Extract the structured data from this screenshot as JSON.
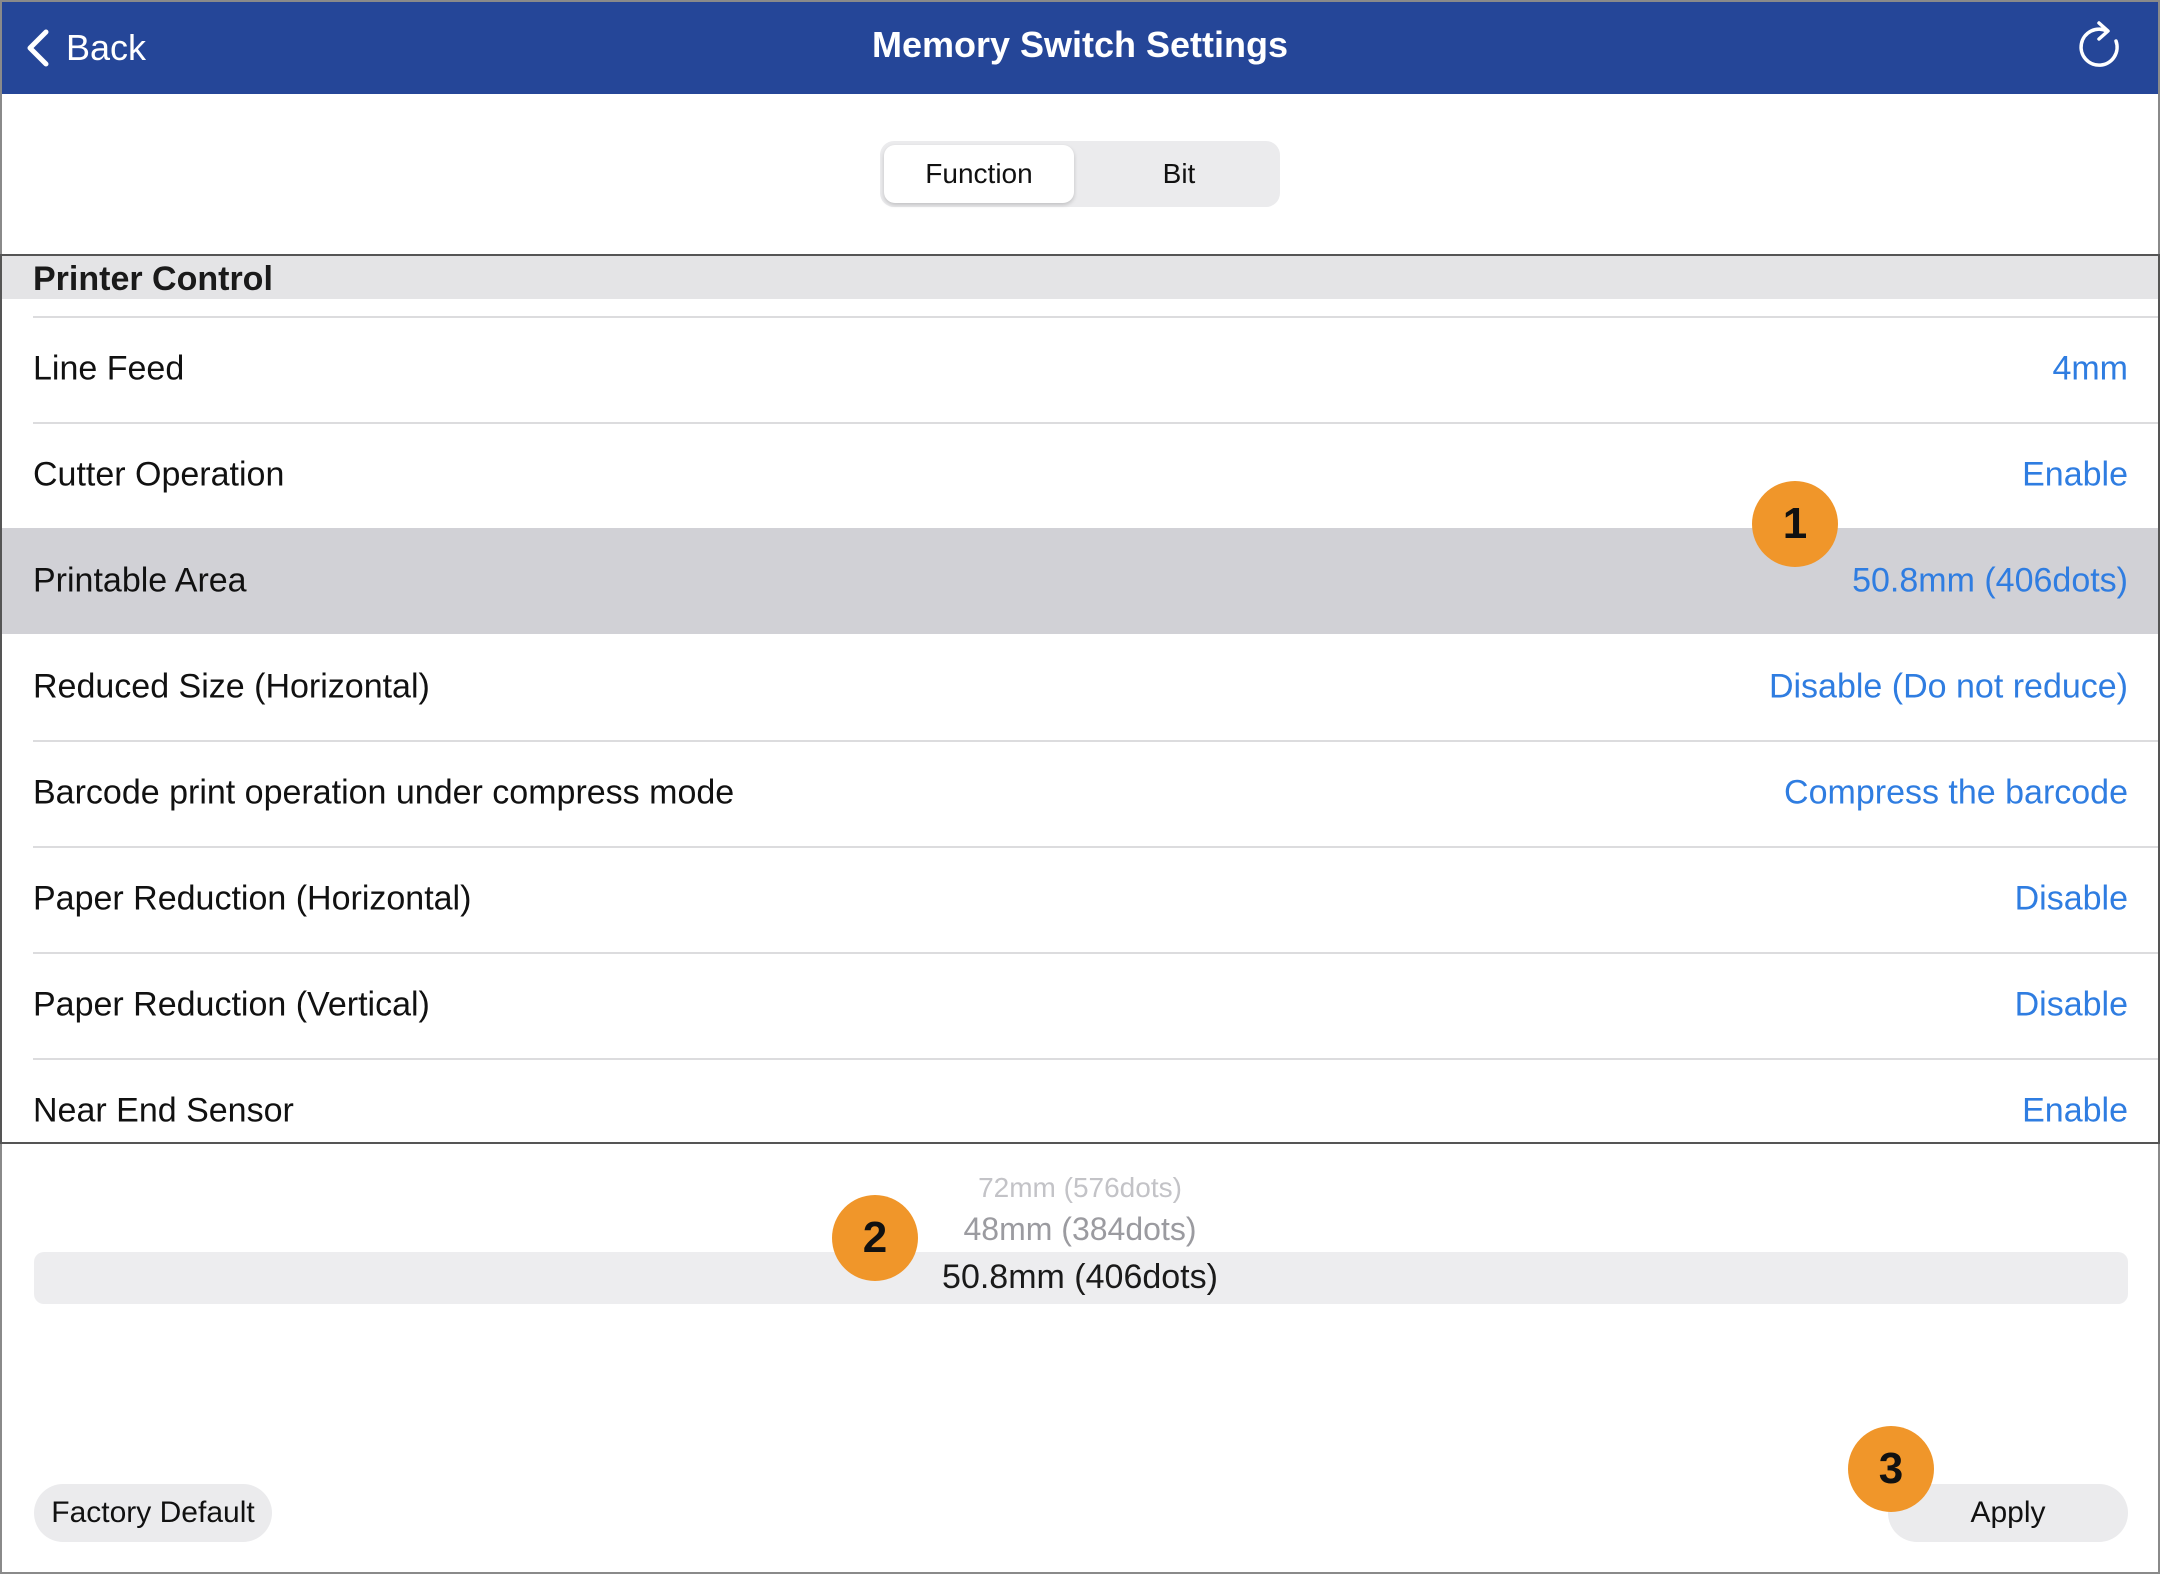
{
  "nav": {
    "back_label": "Back",
    "title": "Memory Switch Settings",
    "bar_color": "#254698"
  },
  "tabs": [
    {
      "label": "Function",
      "selected": true
    },
    {
      "label": "Bit",
      "selected": false
    }
  ],
  "section": {
    "title": "Printer Control"
  },
  "rows": [
    {
      "label": "Line Feed",
      "value": "4mm"
    },
    {
      "label": "Cutter Operation",
      "value": "Enable"
    },
    {
      "label": "Printable Area",
      "value": "50.8mm (406dots)",
      "selected": true
    },
    {
      "label": "Reduced Size (Horizontal)",
      "value": "Disable (Do not reduce)"
    },
    {
      "label": "Barcode print operation under compress mode",
      "value": "Compress the barcode"
    },
    {
      "label": "Paper Reduction (Horizontal)",
      "value": "Disable"
    },
    {
      "label": "Paper Reduction (Vertical)",
      "value": "Disable"
    },
    {
      "label": "Near End Sensor",
      "value": "Enable"
    }
  ],
  "picker": {
    "options": [
      "72mm (576dots)",
      "48mm (384dots)",
      "50.8mm (406dots)"
    ],
    "selected": "50.8mm (406dots)"
  },
  "buttons": {
    "factory_default": "Factory Default",
    "apply": "Apply"
  },
  "callouts": [
    "1",
    "2",
    "3"
  ],
  "colors": {
    "accent_value": "#2f7de1",
    "callout": "#f0962a",
    "selected_row": "#d1d1d6"
  }
}
